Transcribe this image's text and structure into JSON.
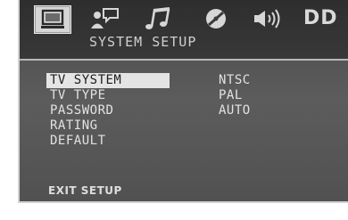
{
  "top_icons": [
    {
      "name": "monitor-icon",
      "active": true
    },
    {
      "name": "speech-person-icon",
      "active": false
    },
    {
      "name": "music-note-icon",
      "active": false
    },
    {
      "name": "disc-icon",
      "active": false
    },
    {
      "name": "speaker-icon",
      "active": false
    }
  ],
  "dd_label": "DD",
  "submenu_title": "SYSTEM SETUP",
  "menu_items": [
    "TV SYSTEM",
    "TV TYPE",
    "PASSWORD",
    "RATING",
    "DEFAULT"
  ],
  "selected_item": "TV SYSTEM",
  "options": [
    "NTSC",
    "PAL",
    "AUTO"
  ],
  "exit_label": "EXIT SETUP"
}
